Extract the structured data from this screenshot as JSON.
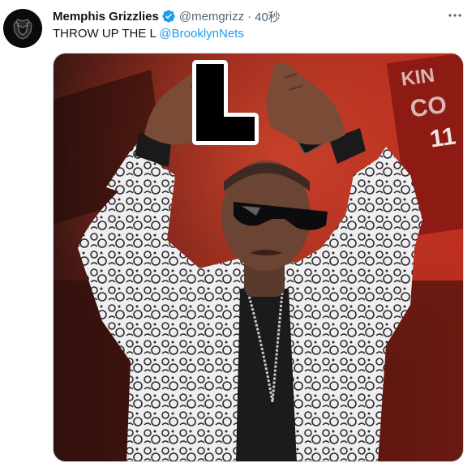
{
  "tweet": {
    "author": {
      "display_name": "Memphis Grizzlies",
      "handle": "@memgrizz",
      "verified": true
    },
    "separator": "·",
    "timestamp": "40秒",
    "text": "THROW UP THE L ",
    "mention": "@BrooklynNets",
    "media": {
      "description_hidden": true,
      "overlay_letter": "L",
      "background_text": [
        "KIN",
        "CO",
        "11"
      ]
    }
  },
  "icons": {
    "verified": "verified-badge-icon",
    "more": "more-options-icon",
    "avatar": "grizzlies-logo-icon"
  },
  "colors": {
    "link": "#1d9bf0",
    "text": "#0f1419",
    "secondary": "#536471",
    "border": "#cfd9de"
  }
}
